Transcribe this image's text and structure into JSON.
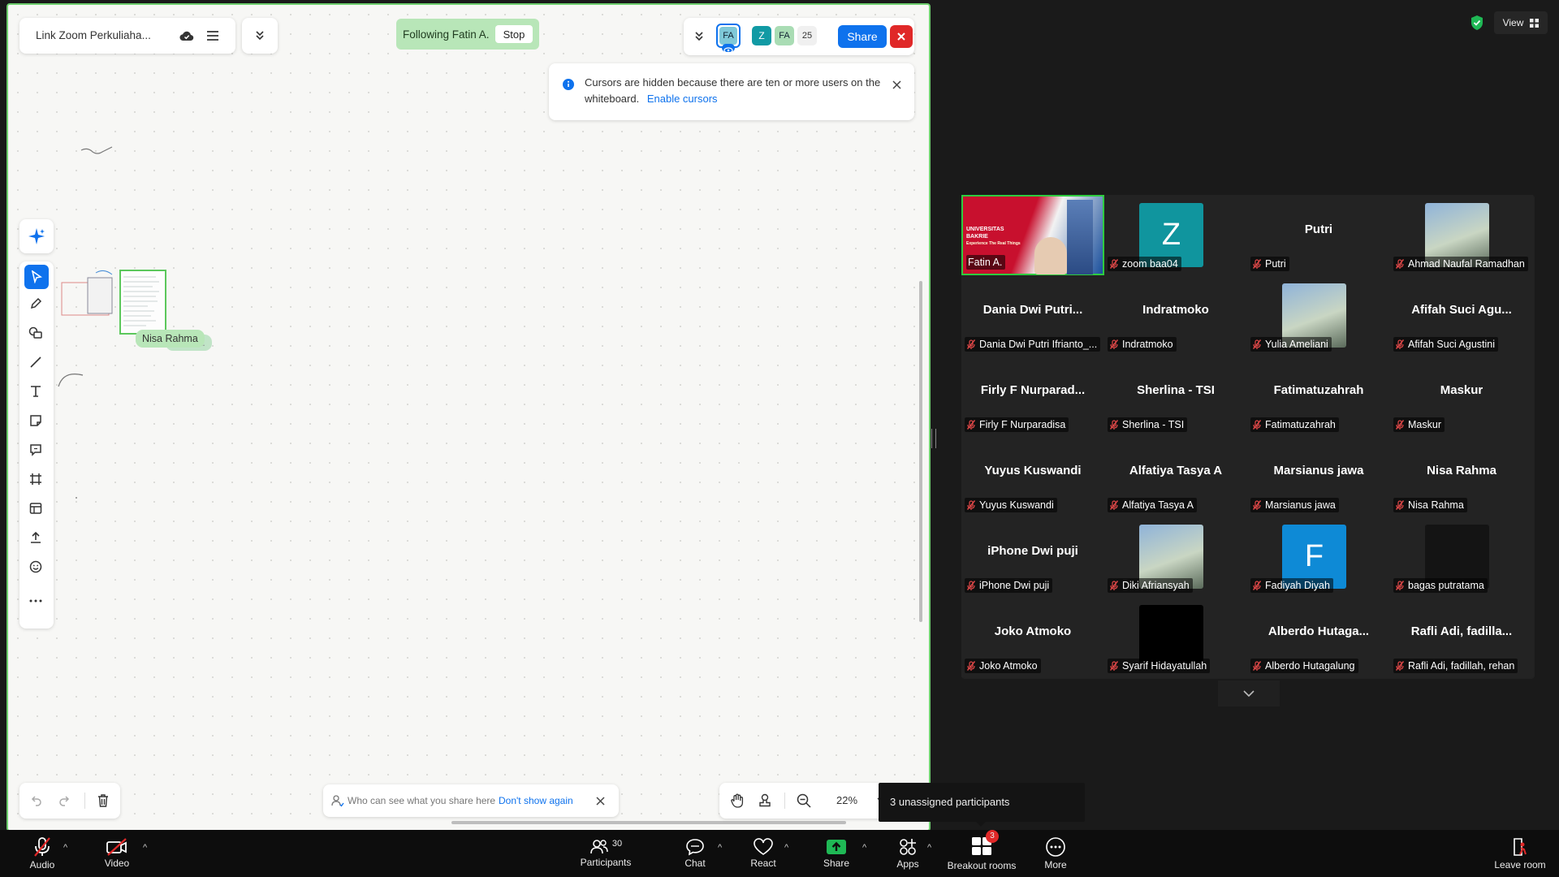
{
  "whiteboard": {
    "title": "Link Zoom Perkuliaha...",
    "following_label": "Following Fatin A.",
    "stop_label": "Stop",
    "avatars": [
      {
        "initials": "FA",
        "color": "#7fc8d8"
      },
      {
        "initials": "Z",
        "color": "#119aa4"
      },
      {
        "initials": "FA",
        "color": "#a9dcb4"
      }
    ],
    "viewer_count": "25",
    "share_label": "Share",
    "notice": {
      "text": "Cursors are hidden because there are ten or more users on the whiteboard.",
      "link": "Enable cursors"
    },
    "canvas_labels": [
      "Nisa Rahma",
      "Fatin A."
    ],
    "share_hint": {
      "text": "Who can see what you share here",
      "link": "Don't show again"
    },
    "zoom_level": "22%",
    "tooltip": "3 unassigned participants"
  },
  "view_button": {
    "label": "View"
  },
  "participants": [
    {
      "big": "",
      "label": "Fatin A.",
      "kind": "video",
      "muted": false
    },
    {
      "big": "",
      "label": "zoom baa04",
      "kind": "avatar",
      "letter": "Z",
      "color": "#10959e",
      "muted": true
    },
    {
      "big": "Putri",
      "label": "Putri",
      "kind": "name",
      "muted": true
    },
    {
      "big": "",
      "label": "Ahmad Naufal Ramadhan",
      "kind": "photo",
      "muted": true
    },
    {
      "big": "Dania Dwi Putri...",
      "label": "Dania Dwi Putri Ifrianto_...",
      "kind": "name",
      "muted": true
    },
    {
      "big": "Indratmoko",
      "label": "Indratmoko",
      "kind": "name",
      "muted": true
    },
    {
      "big": "",
      "label": "Yulia Ameliani",
      "kind": "photo",
      "muted": true
    },
    {
      "big": "Afifah Suci Agu...",
      "label": "Afifah Suci Agustini",
      "kind": "name",
      "muted": true
    },
    {
      "big": "Firly F Nurparad...",
      "label": "Firly F Nurparadisa",
      "kind": "name",
      "muted": true
    },
    {
      "big": "Sherlina - TSI",
      "label": "Sherlina - TSI",
      "kind": "name",
      "muted": true
    },
    {
      "big": "Fatimatuzahrah",
      "label": "Fatimatuzahrah",
      "kind": "name",
      "muted": true
    },
    {
      "big": "Maskur",
      "label": "Maskur",
      "kind": "name",
      "muted": true
    },
    {
      "big": "Yuyus Kuswandi",
      "label": "Yuyus Kuswandi",
      "kind": "name",
      "muted": true
    },
    {
      "big": "Alfatiya Tasya A",
      "label": "Alfatiya Tasya A",
      "kind": "name",
      "muted": true
    },
    {
      "big": "Marsianus jawa",
      "label": "Marsianus jawa",
      "kind": "name",
      "muted": true
    },
    {
      "big": "Nisa Rahma",
      "label": "Nisa Rahma",
      "kind": "name",
      "muted": true
    },
    {
      "big": "iPhone Dwi puji",
      "label": "iPhone Dwi puji",
      "kind": "name",
      "muted": true
    },
    {
      "big": "",
      "label": "Diki Afriansyah",
      "kind": "photo",
      "muted": true
    },
    {
      "big": "",
      "label": "Fadiyah Diyah",
      "kind": "avatar",
      "letter": "F",
      "color": "#0e8ad6",
      "muted": true
    },
    {
      "big": "",
      "label": "bagas putratama",
      "kind": "dark",
      "muted": true
    },
    {
      "big": "Joko Atmoko",
      "label": "Joko Atmoko",
      "kind": "name",
      "muted": true
    },
    {
      "big": "",
      "label": "Syarif Hidayatullah",
      "kind": "black",
      "muted": true
    },
    {
      "big": "Alberdo Hutaga...",
      "label": "Alberdo Hutagalung",
      "kind": "name",
      "muted": true
    },
    {
      "big": "Rafli Adi, fadilla...",
      "label": "Rafli Adi, fadillah, rehan",
      "kind": "name",
      "muted": true
    }
  ],
  "video_banner": {
    "line1": "UNIVERSITAS",
    "line2": "BAKRIE",
    "line3": "Experience The Real Things"
  },
  "controls": {
    "audio": "Audio",
    "video": "Video",
    "participants": "Participants",
    "participants_count": "30",
    "chat": "Chat",
    "react": "React",
    "share": "Share",
    "apps": "Apps",
    "breakout": "Breakout rooms",
    "breakout_badge": "3",
    "more": "More",
    "leave": "Leave room"
  }
}
